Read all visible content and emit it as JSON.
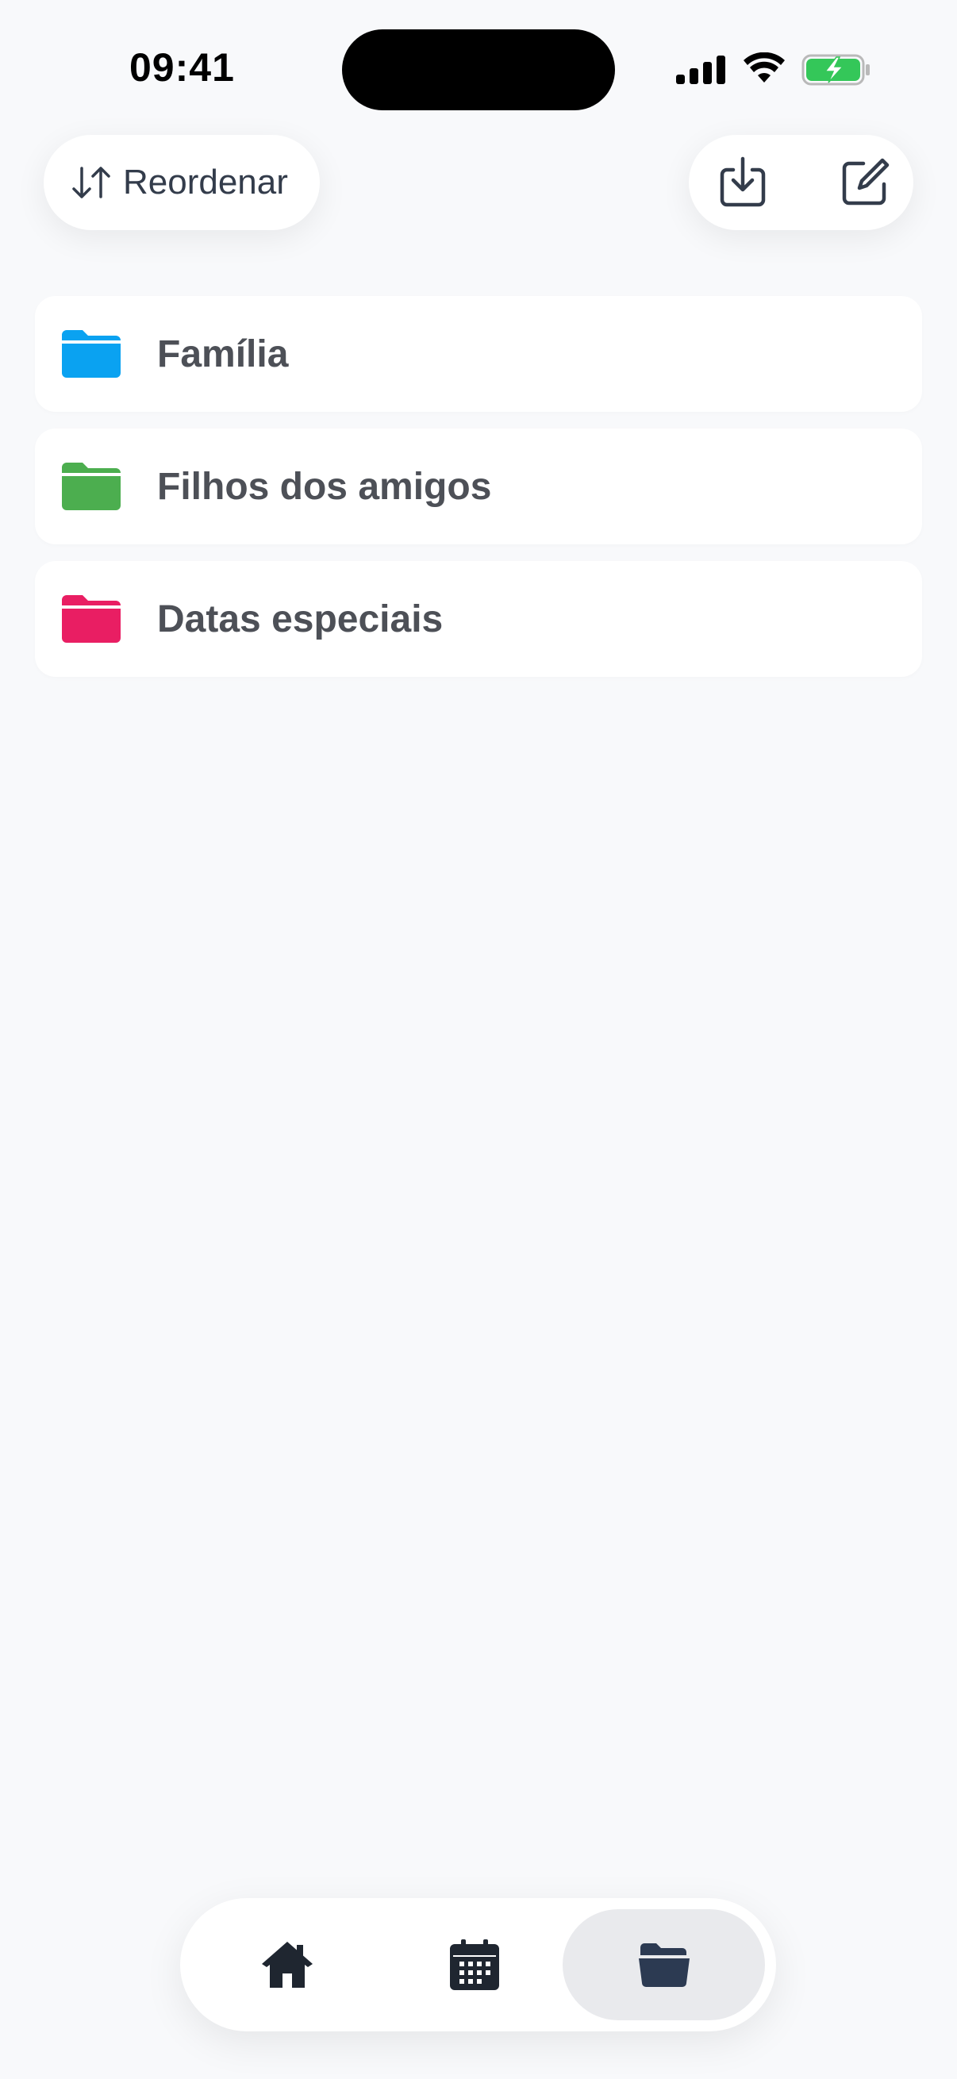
{
  "status_bar": {
    "time": "09:41",
    "icons": [
      "cellular-signal-icon",
      "wifi-icon",
      "battery-charging-icon"
    ]
  },
  "toolbar": {
    "reorder_label": "Reordenar",
    "reorder_icon": "sort-arrows-icon",
    "actions": [
      "import-icon",
      "edit-icon"
    ]
  },
  "folders": [
    {
      "label": "Família",
      "color": "#0aa2f1"
    },
    {
      "label": "Filhos dos amigos",
      "color": "#4cae4f"
    },
    {
      "label": "Datas especiais",
      "color": "#e91e63"
    }
  ],
  "tab_bar": {
    "tabs": [
      {
        "icon": "home-icon",
        "active": false
      },
      {
        "icon": "calendar-icon",
        "active": false
      },
      {
        "icon": "folder-icon",
        "active": true
      }
    ]
  },
  "colors": {
    "background": "#f8f9fb",
    "text_primary": "#4d5057",
    "icon_dark": "#1f2630",
    "active_tab_bg": "#e9eaed",
    "battery_green": "#34c759"
  }
}
